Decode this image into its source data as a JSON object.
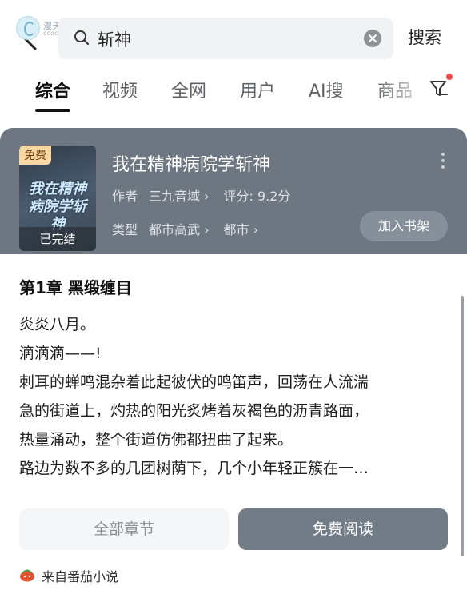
{
  "watermark": {
    "text": "漫天糖动漫",
    "sub": "cooco.com"
  },
  "search": {
    "query": "斩神",
    "button": "搜索"
  },
  "tabs": [
    "综合",
    "视频",
    "全网",
    "用户",
    "AI搜",
    "商品"
  ],
  "book": {
    "badge": "免费",
    "cover_title": "我在精神病院学斩神",
    "status": "已完结",
    "title": "我在精神病院学斩神",
    "author_label": "作者",
    "author": "三九音域",
    "rating": "评分: 9.2分",
    "category_label": "类型",
    "category1": "都市高武",
    "category2": "都市",
    "add_shelf": "加入书架"
  },
  "chapter": {
    "title": "第1章 黑缎缠目",
    "lines": [
      "炎炎八月。",
      "滴滴滴——!",
      "刺耳的蝉鸣混杂着此起彼伏的鸣笛声，回荡在人流湍",
      "急的街道上，灼热的阳光炙烤着灰褐色的沥青路面，",
      "热量涌动，整个街道仿佛都扭曲了起来。",
      "路边为数不多的几团树荫下，几个小年轻正簇在一…"
    ]
  },
  "actions": {
    "all_chapters": "全部章节",
    "free_read": "免费阅读"
  },
  "source": "来自番茄小说",
  "colors": {
    "card_header": "#6e7781",
    "read_button": "#727c86",
    "badge": "#f6d6a2",
    "filter_dot": "#f04b4b"
  }
}
